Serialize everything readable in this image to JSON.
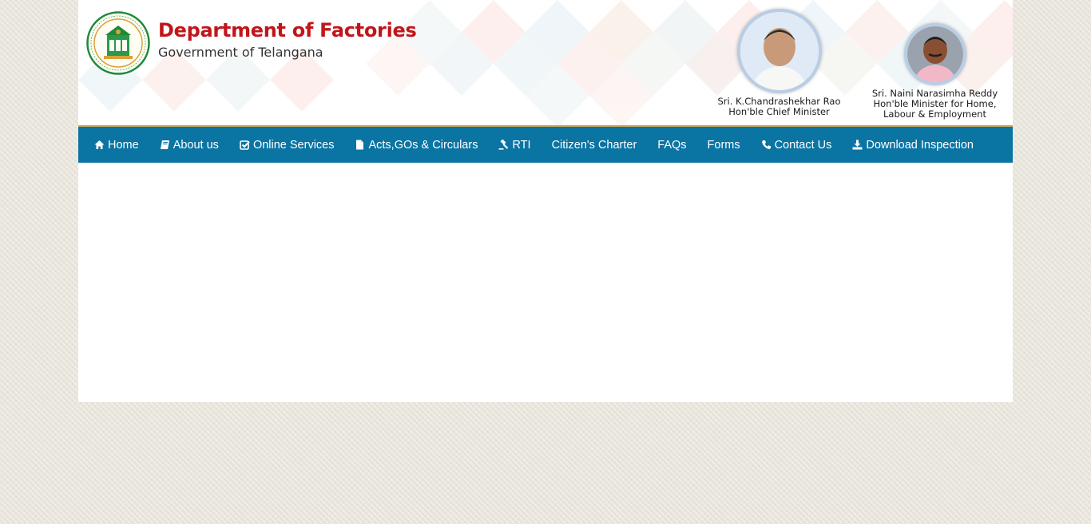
{
  "header": {
    "title": "Department of Factories",
    "subtitle": "Government of Telangana",
    "emblem_icon": "telangana-emblem-icon",
    "leaders": [
      {
        "name": "Sri. K.Chandrashekhar Rao",
        "role_lines": [
          "Hon'ble Chief Minister"
        ]
      },
      {
        "name": "Sri. Naini Narasimha Reddy",
        "role_lines": [
          "Hon'ble Minister for Home,",
          "Labour & Employment"
        ]
      }
    ]
  },
  "nav": {
    "items": [
      {
        "label": "Home",
        "icon": "home-icon"
      },
      {
        "label": "About us",
        "icon": "book-icon"
      },
      {
        "label": "Online Services",
        "icon": "check-square-icon"
      },
      {
        "label": "Acts,GOs & Circulars",
        "icon": "file-icon"
      },
      {
        "label": "RTI",
        "icon": "gavel-icon"
      },
      {
        "label": "Citizen's Charter",
        "icon": ""
      },
      {
        "label": "FAQs",
        "icon": ""
      },
      {
        "label": "Forms",
        "icon": ""
      },
      {
        "label": "Contact Us",
        "icon": "phone-icon"
      },
      {
        "label": "Download Inspection",
        "icon": "download-icon"
      }
    ]
  },
  "colors": {
    "brand_red": "#c0161b",
    "nav_blue": "#0a74a3",
    "nav_border_gold": "#c8a35a",
    "page_bg": "#e9e5dc"
  }
}
